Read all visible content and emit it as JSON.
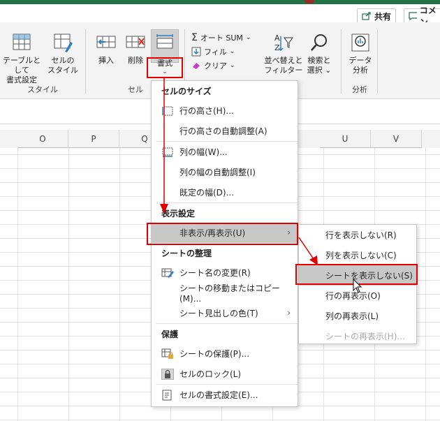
{
  "topbar": {
    "share_label": "共有",
    "comment_label": "コメン"
  },
  "ribbon": {
    "style_group": {
      "label": "スタイル",
      "table_format": [
        "テーブルとして",
        "書式設定"
      ],
      "cell_style": [
        "セルの",
        "スタイル"
      ]
    },
    "cell_group": {
      "label": "セル",
      "insert": "挿入",
      "delete": "削除",
      "format": "書式"
    },
    "edit_group": {
      "autosum": "オート SUM",
      "fill": "フィル",
      "clear": "クリア",
      "sort_filter": [
        "並べ替えと",
        "フィルター"
      ],
      "find_select": [
        "検索と",
        "選択"
      ]
    },
    "analysis_group": {
      "label": "分析",
      "data_analysis": [
        "データ",
        "分析"
      ]
    }
  },
  "sheet": {
    "columns": [
      "O",
      "P",
      "Q",
      "U",
      "V"
    ]
  },
  "format_menu": {
    "cell_size_header": "セルのサイズ",
    "row_height": "行の高さ(H)...",
    "autofit_row": "行の高さの自動調整(A)",
    "column_width": "列の幅(W)...",
    "autofit_column": "列の幅の自動調整(I)",
    "default_width": "既定の幅(D)...",
    "visibility_header": "表示設定",
    "hide_unhide": "非表示/再表示(U)",
    "organize_header": "シートの整理",
    "rename_sheet": "シート名の変更(R)",
    "move_copy": "シートの移動またはコピー(M)...",
    "tab_color": "シート見出しの色(T)",
    "protection_header": "保護",
    "protect_sheet": "シートの保護(P)...",
    "lock_cell": "セルのロック(L)",
    "format_cells": "セルの書式設定(E)..."
  },
  "submenu": {
    "hide_rows": "行を表示しない(R)",
    "hide_columns": "列を表示しない(C)",
    "hide_sheet": "シートを表示しない(S)",
    "unhide_rows": "行の再表示(O)",
    "unhide_columns": "列の再表示(L)",
    "unhide_sheet": "シートの再表示(H)..."
  },
  "colors": {
    "excel_green": "#217346",
    "annotation_red": "#e00000",
    "highlight": "#c8c8c8"
  }
}
